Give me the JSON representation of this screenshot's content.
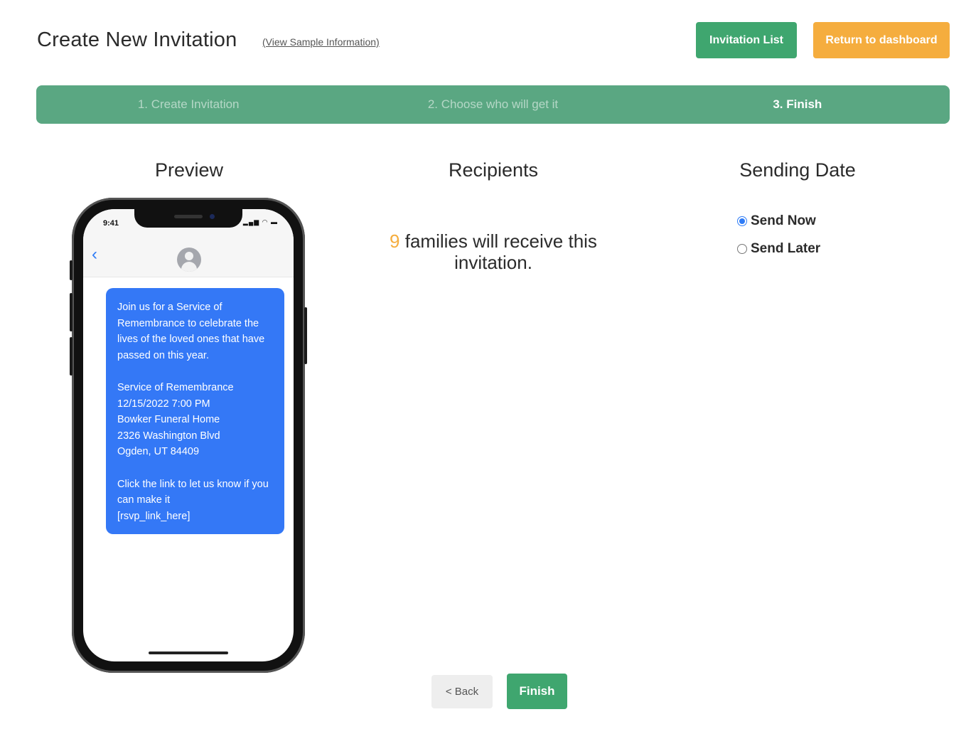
{
  "header": {
    "title": "Create New Invitation",
    "sample_link": "(View Sample Information)",
    "invitation_list_label": "Invitation List",
    "return_dashboard_label": "Return to dashboard",
    "colors": {
      "green": "#3fa66f",
      "orange": "#f5ad3e"
    }
  },
  "stepper": {
    "steps": [
      {
        "label": "1. Create Invitation",
        "active": false
      },
      {
        "label": "2. Choose who will get it",
        "active": false
      },
      {
        "label": "3. Finish",
        "active": true
      }
    ],
    "color": "#5aa782"
  },
  "preview": {
    "title": "Preview",
    "phone": {
      "time": "9:41",
      "status_icons": "signal-wifi-battery-icons",
      "back_icon": "chevron-left-icon",
      "avatar_icon": "contact-avatar-icon",
      "message_paragraphs": [
        "Join us for a Service of Remembrance to celebrate the lives of the loved ones that have passed on this year.",
        "Service of Remembrance\n12/15/2022 7:00 PM\nBowker Funeral Home\n2326 Washington Blvd\nOgden, UT 84409",
        "Click the link to let us know if you can make it\n[rsvp_link_here]"
      ],
      "bubble_color": "#3478f6"
    }
  },
  "recipients": {
    "title": "Recipients",
    "count": "9",
    "text": "families will receive this invitation."
  },
  "sending_date": {
    "title": "Sending Date",
    "options": [
      {
        "label": "Send Now",
        "checked": true
      },
      {
        "label": "Send Later",
        "checked": false
      }
    ]
  },
  "footer": {
    "back_label": "< Back",
    "finish_label": "Finish"
  }
}
